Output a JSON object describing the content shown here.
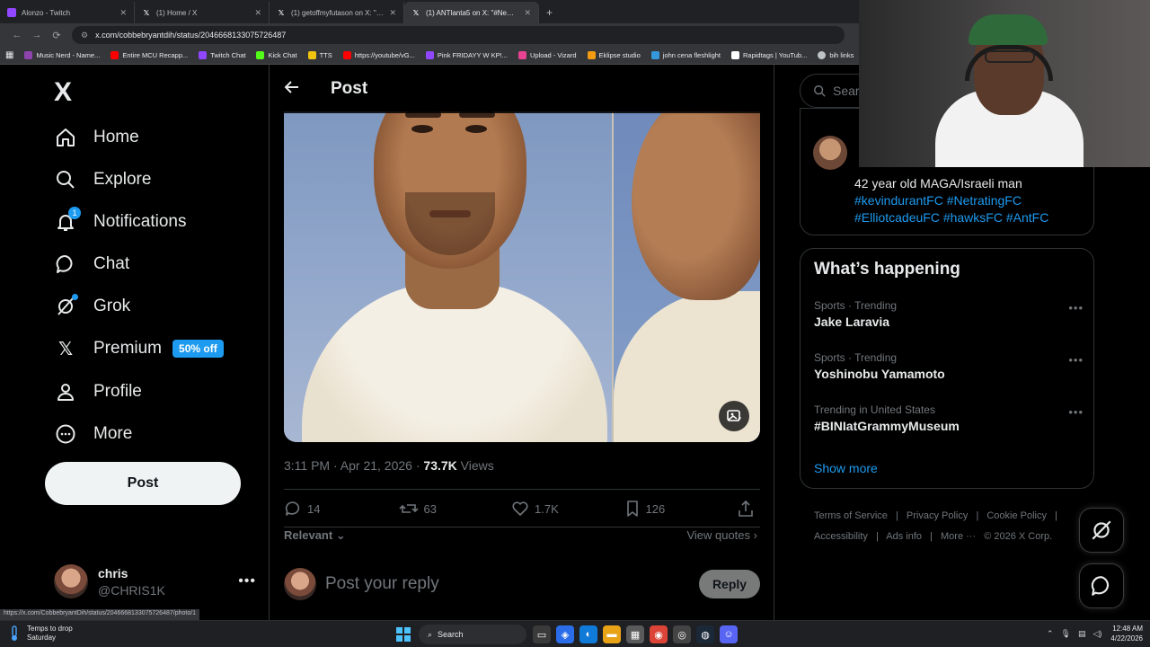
{
  "browser": {
    "tabs": [
      {
        "title": "Alonzo - Twitch",
        "color": "#9146ff",
        "active": false
      },
      {
        "title": "(1) Home / X",
        "color": "#000000",
        "active": false
      },
      {
        "title": "(1) getoffmyfutason on X: \"ducl",
        "color": "#000000",
        "active": false
      },
      {
        "title": "(1) ANTlanta5 on X: \"#NewProfil",
        "color": "#000000",
        "active": true
      }
    ],
    "url": "x.com/cobbebryantdih/status/2046668133075726487",
    "bookmarks": [
      {
        "label": "Music Nerd - Name...",
        "color": "#8e44ad"
      },
      {
        "label": "Entire MCU Recapp...",
        "color": "#ff0000"
      },
      {
        "label": "Twitch Chat",
        "color": "#9146ff"
      },
      {
        "label": "Kick Chat",
        "color": "#53fc18"
      },
      {
        "label": "TTS",
        "color": "#f1c40f"
      },
      {
        "label": "https://youtube/vG...",
        "color": "#ff0000"
      },
      {
        "label": "Pink FRIDAYY W KP!...",
        "color": "#9146ff"
      },
      {
        "label": "Upload - Vizard",
        "color": "#e84393"
      },
      {
        "label": "Eklipse studio",
        "color": "#f39c12"
      },
      {
        "label": "john cena fleshlight",
        "color": "#3498db"
      },
      {
        "label": "Rapidtags | YouTub...",
        "color": "#ffffff"
      },
      {
        "label": "bih links",
        "color": "#bdc3c7"
      }
    ],
    "status_url": "https://x.com/CobbebryantDih/status/2046668133075726487/photo/1"
  },
  "nav": {
    "logo": "X",
    "items": [
      {
        "label": "Home",
        "icon": "home-icon"
      },
      {
        "label": "Explore",
        "icon": "search-icon"
      },
      {
        "label": "Notifications",
        "icon": "bell-icon",
        "badge": "1"
      },
      {
        "label": "Chat",
        "icon": "chat-bubble-icon"
      },
      {
        "label": "Grok",
        "icon": "grok-icon"
      },
      {
        "label": "Premium",
        "icon": "x-logo-icon",
        "promo": "50% off"
      },
      {
        "label": "Profile",
        "icon": "person-icon"
      },
      {
        "label": "More",
        "icon": "more-circle-icon"
      }
    ],
    "post_button": "Post",
    "account": {
      "display_name": "chris",
      "handle": "@CHRIS1K"
    }
  },
  "post": {
    "header_title": "Post",
    "time": "3:11 PM",
    "date": "Apr 21, 2026",
    "views_count": "73.7K",
    "views_label": "Views",
    "replies": "14",
    "reposts": "63",
    "likes": "1.7K",
    "bookmarks": "126",
    "sort_label": "Relevant",
    "view_quotes": "View quotes",
    "reply_placeholder": "Post your reply",
    "reply_button": "Reply"
  },
  "sidebar": {
    "search_placeholder": "Searc",
    "bio_text": "42 year old MAGA/Israeli man",
    "bio_tags": "#kevindurantFC #NetratingFC #ElliotcadeuFC #hawksFC #AntFC",
    "happening_title": "What’s happening",
    "trends": [
      {
        "context": "Sports · Trending",
        "name": "Jake Laravia"
      },
      {
        "context": "Sports · Trending",
        "name": "Yoshinobu Yamamoto"
      },
      {
        "context": "Trending in United States",
        "name": "#BINIatGrammyMuseum"
      }
    ],
    "show_more": "Show more",
    "footer_links": [
      "Terms of Service",
      "|",
      "Privacy Policy",
      "|",
      "Cookie Policy",
      "|",
      "Accessibility",
      "|",
      "Ads info",
      "|",
      "More ···",
      "© 2026 X Corp."
    ]
  },
  "taskbar": {
    "weather_line1": "Temps to drop",
    "weather_line2": "Saturday",
    "search_label": "Search",
    "time": "12:48 AM",
    "date": "4/22/2026"
  },
  "colors": {
    "accent": "#1d9bf0",
    "background": "#000000",
    "border": "#2f3336",
    "muted": "#71767b"
  }
}
